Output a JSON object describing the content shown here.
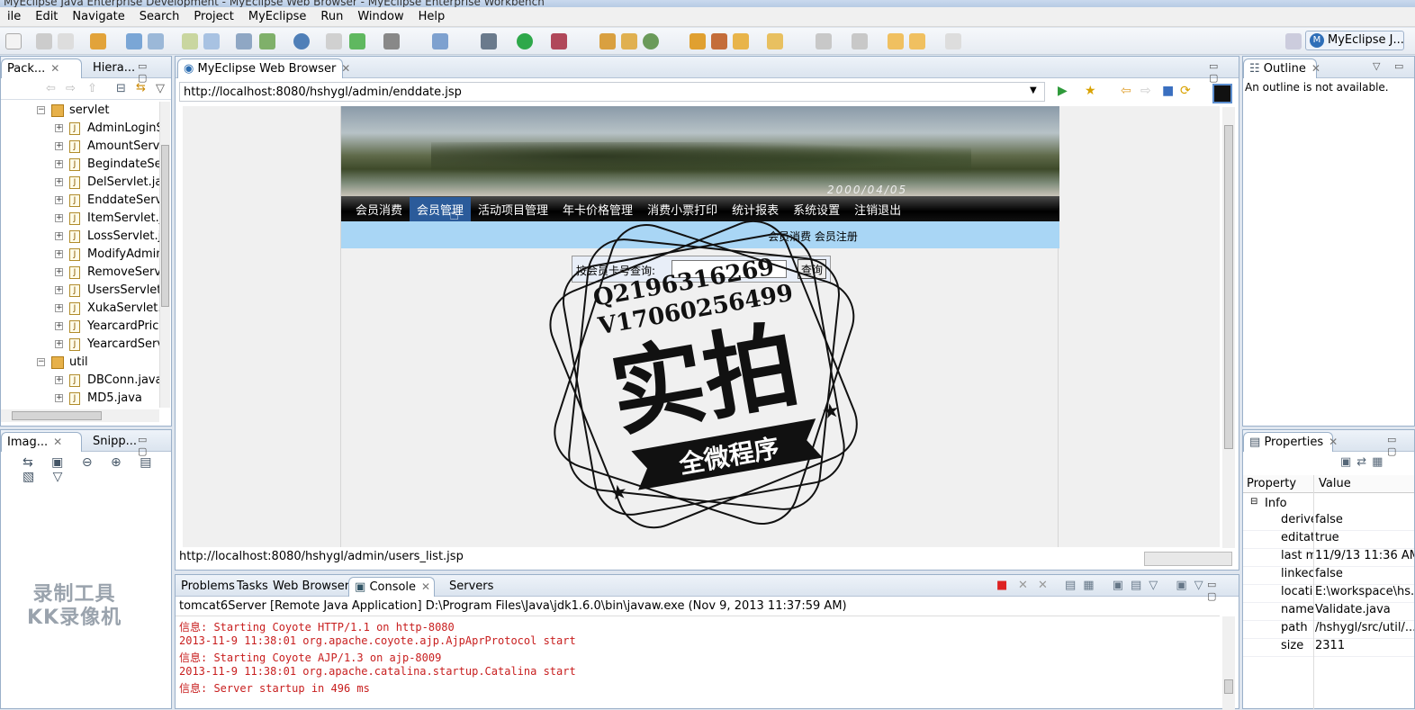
{
  "window": {
    "title": "MyEclipse Java Enterprise Development - MyEclipse Web Browser - MyEclipse Enterprise Workbench"
  },
  "menu": [
    "ile",
    "Edit",
    "Navigate",
    "Search",
    "Project",
    "MyEclipse",
    "Run",
    "Window",
    "Help"
  ],
  "perspective": {
    "label": "MyEclipse J..."
  },
  "left_top": {
    "tabs": [
      "Pack...",
      "Hiera..."
    ],
    "tree": [
      {
        "label": "servlet",
        "type": "package",
        "indent": 1
      },
      {
        "label": "AdminLoginS",
        "type": "java"
      },
      {
        "label": "AmountServle",
        "type": "java"
      },
      {
        "label": "BegindateSer",
        "type": "java"
      },
      {
        "label": "DelServlet.jav",
        "type": "java"
      },
      {
        "label": "EnddateServl",
        "type": "java"
      },
      {
        "label": "ItemServlet.ja",
        "type": "java"
      },
      {
        "label": "LossServlet.ja",
        "type": "java"
      },
      {
        "label": "ModifyAdmin",
        "type": "java"
      },
      {
        "label": "RemoveServl",
        "type": "java"
      },
      {
        "label": "UsersServlet.",
        "type": "java"
      },
      {
        "label": "XukaServlet.j",
        "type": "java"
      },
      {
        "label": "YearcardPrice",
        "type": "java"
      },
      {
        "label": "YearcardServ",
        "type": "java"
      },
      {
        "label": "util",
        "type": "package",
        "indent": 1
      },
      {
        "label": "DBConn.java",
        "type": "java"
      },
      {
        "label": "MD5.java",
        "type": "java"
      }
    ]
  },
  "left_bottom": {
    "tabs": [
      "Imag...",
      "Snipp..."
    ]
  },
  "browser": {
    "tab": "MyEclipse Web Browser",
    "url": "http://localhost:8080/hshygl/admin/enddate.jsp",
    "status": "http://localhost:8080/hshygl/admin/users_list.jsp",
    "site": {
      "banner_date": "2000/04/05",
      "nav": [
        "会员消费",
        "会员管理",
        "活动项目管理",
        "年卡价格管理",
        "消费小票打印",
        "统计报表",
        "系统设置",
        "注销退出"
      ],
      "subnav": "会员消费  会员注册",
      "search_label": "按会员卡号查询:",
      "search_button": "查询"
    }
  },
  "outline": {
    "title": "Outline",
    "message": "An outline is not available."
  },
  "properties": {
    "title": "Properties",
    "headers": [
      "Property",
      "Value"
    ],
    "group": "Info",
    "rows": [
      {
        "k": "derive",
        "v": "false"
      },
      {
        "k": "editat",
        "v": "true"
      },
      {
        "k": "last m",
        "v": "11/9/13 11:36 AM"
      },
      {
        "k": "linkec",
        "v": "false"
      },
      {
        "k": "locati",
        "v": "E:\\workspace\\hs..."
      },
      {
        "k": "name",
        "v": "Validate.java"
      },
      {
        "k": "path",
        "v": "/hshygl/src/util/..."
      },
      {
        "k": "size",
        "v": "2311"
      }
    ]
  },
  "console": {
    "tabs": [
      "Problems",
      "Tasks",
      "Web Browser",
      "Console",
      "Servers"
    ],
    "header": "tomcat6Server [Remote Java Application] D:\\Program Files\\Java\\jdk1.6.0\\bin\\javaw.exe (Nov 9, 2013 11:37:59 AM)",
    "lines": [
      "信息: Starting Coyote HTTP/1.1 on http-8080",
      "2013-11-9 11:38:01 org.apache.coyote.ajp.AjpAprProtocol start",
      "信息: Starting Coyote AJP/1.3 on ajp-8009",
      "2013-11-9 11:38:01 org.apache.catalina.startup.Catalina start",
      "信息: Server startup in 496 ms"
    ]
  },
  "overlay": {
    "qq": "Q2196316269",
    "v": "V17060256499",
    "big": "实拍",
    "ribbon": "全微程序",
    "recorder_line1": "录制工具",
    "recorder_line2": "KK录像机"
  }
}
